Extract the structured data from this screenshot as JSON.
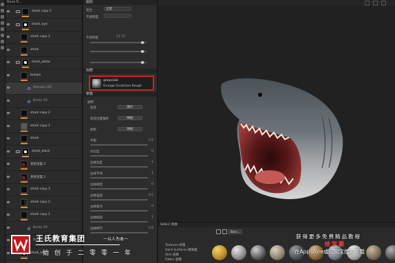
{
  "layers": {
    "tab_label": "Base B...",
    "rows": [
      {
        "name": "shark copy 2",
        "value": "",
        "type": "group"
      },
      {
        "name": "shark_eye",
        "value": "",
        "type": "group"
      },
      {
        "name": "shark copy 1",
        "value": "",
        "type": "layer"
      },
      {
        "name": "shark",
        "value": "",
        "type": "layer"
      },
      {
        "name": "shark_white",
        "value": "",
        "type": "group"
      },
      {
        "name": "bumps",
        "value": "",
        "type": "layer"
      },
      {
        "name": "Sharpen 2D",
        "value": "",
        "type": "effect"
      },
      {
        "name": "Bump 2D",
        "value": "",
        "type": "effect"
      },
      {
        "name": "shark copy 2",
        "value": "",
        "type": "layer"
      },
      {
        "name": "shark copy 1",
        "value": "",
        "type": "layer"
      },
      {
        "name": "shark",
        "value": "",
        "type": "layer"
      },
      {
        "name": "shark_black",
        "value": "",
        "type": "group"
      },
      {
        "name": "黑色深度 2",
        "value": "",
        "type": "layer"
      },
      {
        "name": "黑色深度 1",
        "value": "",
        "type": "layer"
      },
      {
        "name": "shark copy 3",
        "value": "",
        "type": "layer"
      },
      {
        "name": "shark copy 2",
        "value": "",
        "type": "layer"
      },
      {
        "name": "shark copy 1",
        "value": "",
        "type": "layer"
      },
      {
        "name": "Bump 2D",
        "value": "",
        "type": "effect"
      },
      {
        "name": "Bump 2D",
        "value": "",
        "type": "effect"
      },
      {
        "name": "shark_teeth",
        "value": "",
        "type": "layer"
      }
    ]
  },
  "properties": {
    "header_layer": "图层",
    "blend_label": "混合",
    "blend_value": "正常",
    "opacity_label": "不透明度",
    "opacity_value": "11.72",
    "header_material": "材质",
    "material_name": "greyscale",
    "material_sub": "Grunge Scratches Rough",
    "header_params": "参数",
    "section_general": "通用",
    "rows": [
      {
        "label": "渐变",
        "value": "图片"
      },
      {
        "label": "渐变位置偏移",
        "value": "映射"
      },
      {
        "label": "颜色",
        "value": "映射"
      },
      {
        "label": "平衡",
        "value": "0.5"
      },
      {
        "label": "对比度",
        "value": "0"
      },
      {
        "label": "边缘宽度",
        "value": "1"
      },
      {
        "label": "边缘平滑",
        "value": "1"
      },
      {
        "label": "边缘硬度",
        "value": "0"
      },
      {
        "label": "边缘强度",
        "value": "0.5"
      },
      {
        "label": "边缘噪点",
        "value": "0"
      },
      {
        "label": "边缘缩放",
        "value": "1"
      },
      {
        "label": "边缘细节",
        "value": "0.6"
      }
    ]
  },
  "shelf": {
    "title": "SHELF 资源",
    "search_value": "Base...",
    "categories": [
      "Textures 纹理",
      "Hard Surfaces 硬表面",
      "Skin 皮肤",
      "Filters 滤镜"
    ]
  },
  "watermark": {
    "brand_title": "王氏教育集团",
    "slogan": "一以人为本一",
    "motto": "始创于二零零一年",
    "promo_top": "获得更多免费精品教程",
    "promo_brand": "绘学霸",
    "promo_bottom": "在AppStore或应用宝搜索下载"
  },
  "colors": {
    "highlight": "#d42020",
    "accent_orange": "#e08a2a",
    "watermark_red": "#c8161d"
  }
}
